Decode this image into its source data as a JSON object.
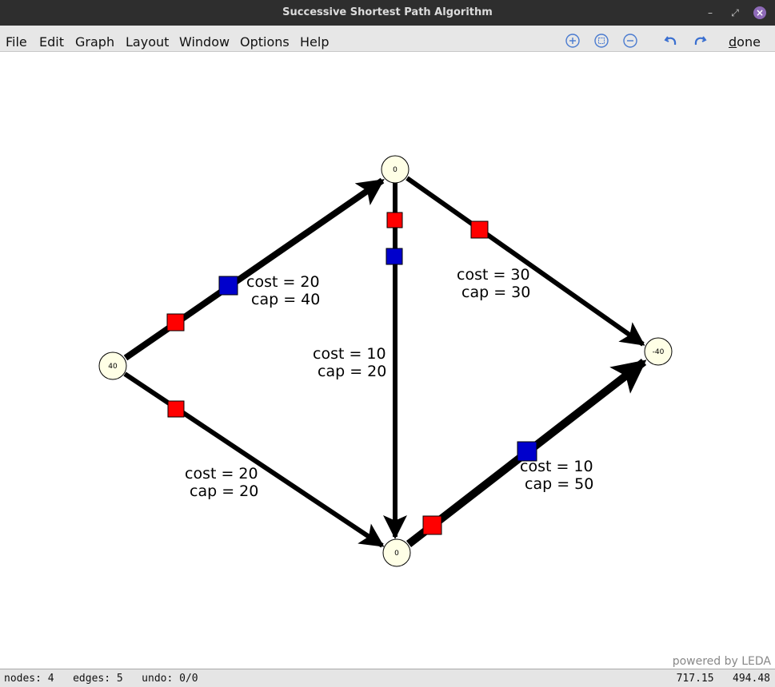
{
  "window": {
    "title": "Successive Shortest Path Algorithm",
    "controls": [
      "minimize",
      "restore",
      "close"
    ]
  },
  "menubar": {
    "items": [
      "File",
      "Edit",
      "Graph",
      "Layout",
      "Window",
      "Options",
      "Help"
    ],
    "tools": [
      "zoom-in-icon",
      "zoom-fit-icon",
      "zoom-out-icon",
      "undo-icon",
      "redo-icon"
    ],
    "done_underlined": "d",
    "done_rest": "one"
  },
  "graph": {
    "nodes": [
      {
        "id": "source",
        "label": "40"
      },
      {
        "id": "top",
        "label": "0"
      },
      {
        "id": "bottom",
        "label": "0"
      },
      {
        "id": "sink",
        "label": "-40"
      }
    ],
    "edges": [
      {
        "from": "source",
        "to": "top",
        "cost_label": "cost = 20",
        "cap_label": "cap = 40"
      },
      {
        "from": "source",
        "to": "bottom",
        "cost_label": "cost = 20",
        "cap_label": "cap = 20"
      },
      {
        "from": "top",
        "to": "bottom",
        "cost_label": "cost = 10",
        "cap_label": "cap = 20"
      },
      {
        "from": "top",
        "to": "sink",
        "cost_label": "cost = 30",
        "cap_label": "cap = 30"
      },
      {
        "from": "bottom",
        "to": "sink",
        "cost_label": "cost = 10",
        "cap_label": "cap = 50"
      }
    ],
    "colors": {
      "node_fill": "#ffffe6",
      "edge": "#000000",
      "marker_red": "#ff0000",
      "marker_blue": "#0000cc"
    }
  },
  "watermark": "powered by LEDA",
  "status": {
    "left": "nodes: 4   edges: 5   undo: 0/0",
    "right": "717.15   494.48"
  }
}
